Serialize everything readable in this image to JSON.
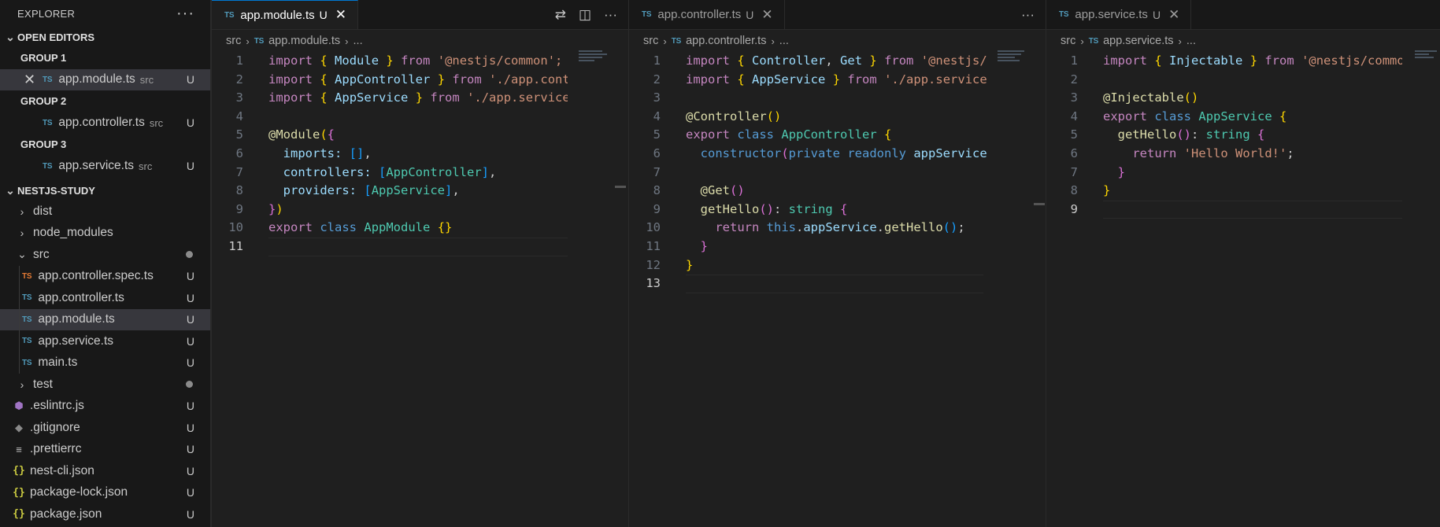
{
  "sidebar": {
    "title": "EXPLORER",
    "more": "···",
    "open_editors": {
      "label": "OPEN EDITORS",
      "groups": [
        {
          "label": "GROUP 1",
          "file": "app.module.ts",
          "dir": "src",
          "status": "U"
        },
        {
          "label": "GROUP 2",
          "file": "app.controller.ts",
          "dir": "src",
          "status": "U"
        },
        {
          "label": "GROUP 3",
          "file": "app.service.ts",
          "dir": "src",
          "status": "U"
        }
      ]
    },
    "project": {
      "label": "NESTJS-STUDY",
      "items": [
        {
          "name": "dist"
        },
        {
          "name": "node_modules"
        },
        {
          "name": "src"
        },
        {
          "name": "app.controller.spec.ts",
          "status": "U"
        },
        {
          "name": "app.controller.ts",
          "status": "U"
        },
        {
          "name": "app.module.ts",
          "status": "U"
        },
        {
          "name": "app.service.ts",
          "status": "U"
        },
        {
          "name": "main.ts",
          "status": "U"
        },
        {
          "name": "test"
        },
        {
          "name": ".eslintrc.js",
          "status": "U"
        },
        {
          "name": ".gitignore",
          "status": "U"
        },
        {
          "name": ".prettierrc",
          "status": "U"
        },
        {
          "name": "nest-cli.json",
          "status": "U"
        },
        {
          "name": "package-lock.json",
          "status": "U"
        },
        {
          "name": "package.json",
          "status": "U"
        }
      ]
    }
  },
  "icons": {
    "ts_badge": "TS",
    "json_badge": "{}",
    "close": "✕",
    "chevron_down": "⌵",
    "chevron_right": "›"
  },
  "editors": [
    {
      "tab": "app.module.ts",
      "tab_status": "U",
      "breadcrumb": {
        "folder": "src",
        "file": "app.module.ts",
        "more": "..."
      },
      "lines": [
        "1",
        "2",
        "3",
        "4",
        "5",
        "6",
        "7",
        "8",
        "9",
        "10",
        "11"
      ]
    },
    {
      "tab": "app.controller.ts",
      "tab_status": "U",
      "breadcrumb": {
        "folder": "src",
        "file": "app.controller.ts",
        "more": "..."
      },
      "lines": [
        "1",
        "2",
        "3",
        "4",
        "5",
        "6",
        "7",
        "8",
        "9",
        "10",
        "11",
        "12",
        "13"
      ]
    },
    {
      "tab": "app.service.ts",
      "tab_status": "U",
      "breadcrumb": {
        "folder": "src",
        "file": "app.service.ts",
        "more": "..."
      },
      "lines": [
        "1",
        "2",
        "3",
        "4",
        "5",
        "6",
        "7",
        "8",
        "9"
      ]
    }
  ],
  "code": {
    "module": {
      "import": "import",
      "from": "from",
      "module_name": "Module",
      "common": "'@nestjs/common';",
      "app_controller": "AppController",
      "controller_path": "'./app.controller';",
      "app_service": "AppService",
      "service_path": "'./app.service';",
      "decorator": "@Module",
      "imports_key": "imports:",
      "controllers_key": "controllers:",
      "providers_key": "providers:",
      "export": "export",
      "class": "class",
      "app_module": "AppModule"
    },
    "controller": {
      "controller_name": "Controller",
      "get_name": "Get",
      "common": "'@nestjs/common';",
      "decorator": "@Controller",
      "get_decorator": "@Get",
      "constructor": "constructor",
      "private": "private",
      "readonly": "readonly",
      "app_service_param": "appService",
      "get_hello": "getHello",
      "string": "string",
      "return": "return",
      "this": "this"
    },
    "service": {
      "injectable": "Injectable",
      "decorator": "@Injectable",
      "hello": "'Hello World!'"
    }
  }
}
